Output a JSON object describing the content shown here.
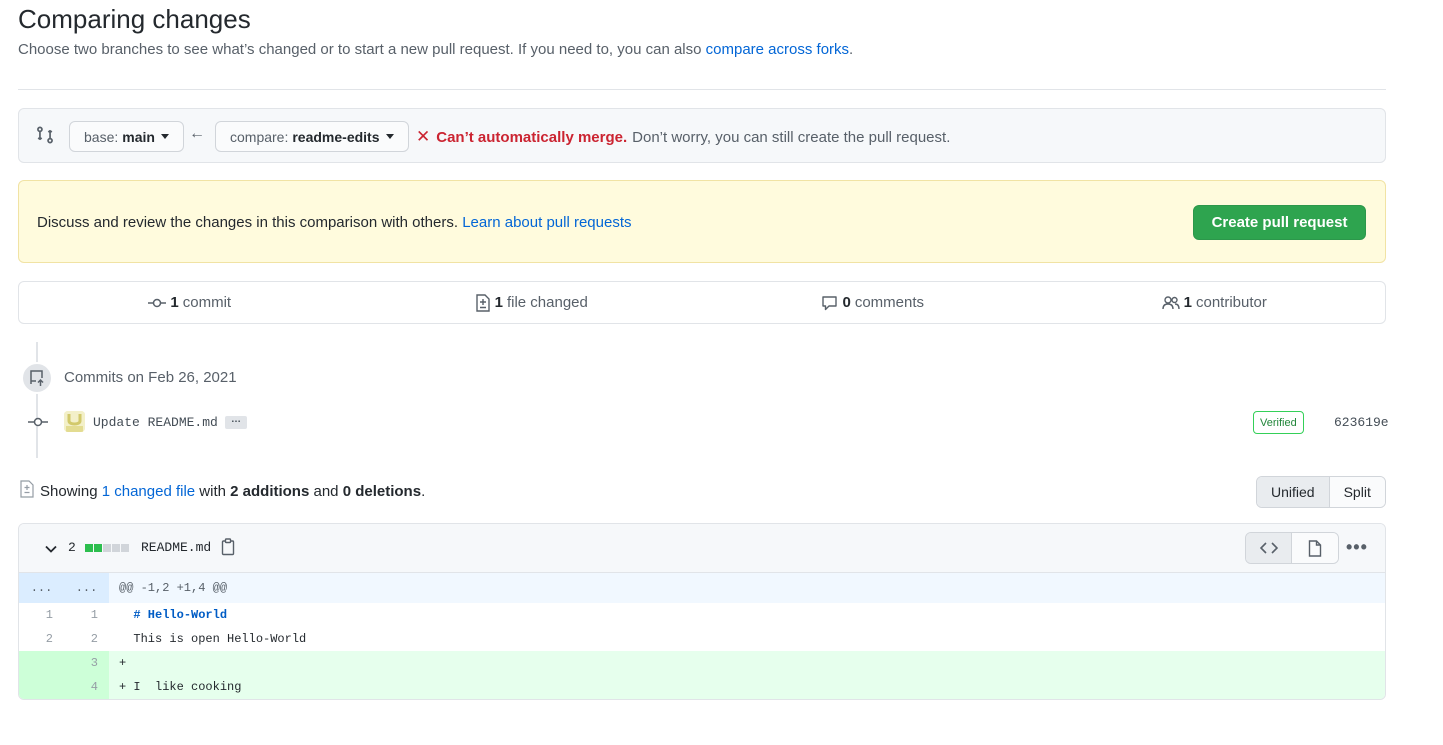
{
  "header": {
    "title": "Comparing changes",
    "subtitle": "Choose two branches to see what’s changed or to start a new pull request. If you need to, you can also ",
    "subtitle_link": "compare across forks",
    "subtitle_end": "."
  },
  "range": {
    "base_label": "base:",
    "base_value": "main",
    "compare_label": "compare:",
    "compare_value": "readme-edits",
    "merge_bad": "Can’t automatically merge.",
    "merge_note": "Don’t worry, you can still create the pull request."
  },
  "flash": {
    "text": "Discuss and review the changes in this comparison with others. ",
    "link": "Learn about pull requests",
    "button": "Create pull request"
  },
  "summary": {
    "commits_count": "1",
    "commits_label": "commit",
    "files_count": "1",
    "files_label": "file changed",
    "comments_count": "0",
    "comments_label": "comments",
    "contributors_count": "1",
    "contributors_label": "contributor"
  },
  "timeline": {
    "heading": "Commits on Feb 26, 2021",
    "commit_message": "Update README.md",
    "ellipsis": "…",
    "verified": "Verified",
    "sha": "623619e"
  },
  "toc": {
    "showing": "Showing ",
    "changed_files_link": "1 changed file",
    "with": " with ",
    "additions": "2 additions",
    "and": " and ",
    "deletions": "0 deletions",
    "end": ".",
    "view_unified": "Unified",
    "view_split": "Split"
  },
  "file": {
    "diffstat_count": "2",
    "name": "README.md",
    "hunk": {
      "left": "...",
      "right": "...",
      "text": "@@ -1,2 +1,4 @@"
    },
    "lines": [
      {
        "left": "1",
        "right": "1",
        "prefix": " ",
        "text": "# Hello-World",
        "type": "context-heading"
      },
      {
        "left": "2",
        "right": "2",
        "prefix": " ",
        "text": "This is open Hello-World",
        "type": "context"
      },
      {
        "left": "",
        "right": "3",
        "prefix": "+",
        "text": "",
        "type": "add"
      },
      {
        "left": "",
        "right": "4",
        "prefix": "+",
        "text": " I  like cooking",
        "type": "add"
      }
    ]
  },
  "colors": {
    "green": "#2ea44f",
    "red": "#cb2431",
    "link": "#0366d6"
  }
}
